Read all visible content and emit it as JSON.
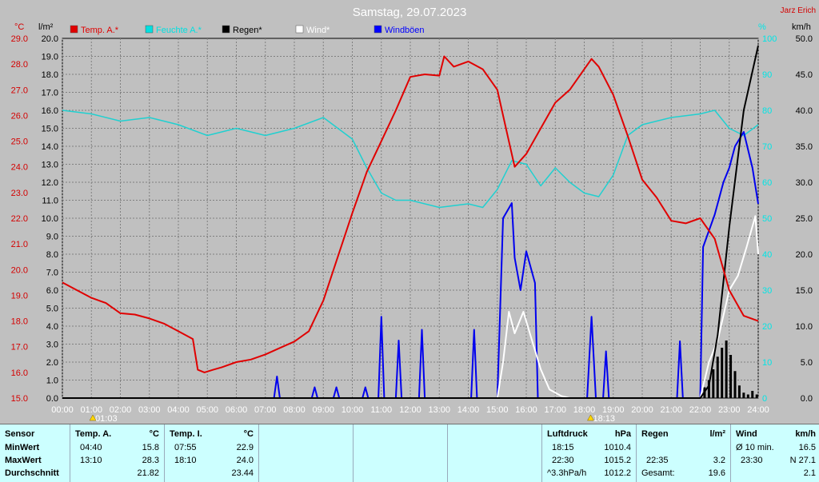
{
  "chart_title": "Samstag, 29.07.2023",
  "author": "Jarz Erich",
  "legend": [
    {
      "name": "Temp. A.*",
      "color": "#e00000"
    },
    {
      "name": "Feuchte A.*",
      "color": "#00e0e0"
    },
    {
      "name": "Regen*",
      "color": "#000000"
    },
    {
      "name": "Wind*",
      "color": "#ffffff"
    },
    {
      "name": "Windböen",
      "color": "#0000ff"
    }
  ],
  "unit_labels": {
    "temp": "°C",
    "rain": "l/m²",
    "humidity": "%",
    "wind": "km/h"
  },
  "markers": [
    {
      "label": "01:03",
      "x": 1.05
    },
    {
      "label": "18:13",
      "x": 18.22
    }
  ],
  "colors": {
    "temp": "#e00000",
    "humidity": "#20d0d0",
    "rain": "#000000",
    "wind": "#ffffff",
    "gusts": "#0000ee",
    "plot_bg": "#c0c0c0",
    "grid": "#808080"
  },
  "chart_data": {
    "type": "line",
    "title": "Samstag, 29.07.2023",
    "x_range": [
      0,
      24
    ],
    "x_ticks": [
      "00:00",
      "01:00",
      "02:00",
      "03:00",
      "04:00",
      "05:00",
      "06:00",
      "07:00",
      "08:00",
      "09:00",
      "10:00",
      "11:00",
      "12:00",
      "13:00",
      "14:00",
      "15:00",
      "16:00",
      "17:00",
      "18:00",
      "19:00",
      "20:00",
      "21:00",
      "22:00",
      "23:00",
      "24:00"
    ],
    "axes": {
      "temp": {
        "range": [
          15,
          29
        ],
        "ticks": [
          "15.0",
          "16.0",
          "17.0",
          "18.0",
          "19.0",
          "20.0",
          "21.0",
          "22.0",
          "23.0",
          "24.0",
          "25.0",
          "26.0",
          "27.0",
          "28.0",
          "29.0"
        ]
      },
      "rain": {
        "range": [
          0,
          20
        ],
        "ticks": [
          "0.0",
          "1.0",
          "2.0",
          "3.0",
          "4.0",
          "5.0",
          "6.0",
          "7.0",
          "8.0",
          "9.0",
          "10.0",
          "11.0",
          "12.0",
          "13.0",
          "14.0",
          "15.0",
          "16.0",
          "17.0",
          "18.0",
          "19.0",
          "20.0"
        ]
      },
      "humidity": {
        "range": [
          0,
          100
        ],
        "ticks": [
          "0",
          "10",
          "20",
          "30",
          "40",
          "50",
          "60",
          "70",
          "80",
          "90",
          "100"
        ]
      },
      "wind": {
        "range": [
          0,
          50
        ],
        "ticks": [
          "0.0",
          "5.0",
          "10.0",
          "15.0",
          "20.0",
          "25.0",
          "30.0",
          "35.0",
          "40.0",
          "45.0",
          "50.0"
        ]
      }
    },
    "series": [
      {
        "name": "Temp. A.*",
        "axis": "temp",
        "points": [
          [
            0,
            19.5
          ],
          [
            0.5,
            19.2
          ],
          [
            1,
            18.9
          ],
          [
            1.5,
            18.7
          ],
          [
            2,
            18.3
          ],
          [
            2.5,
            18.25
          ],
          [
            3,
            18.1
          ],
          [
            3.5,
            17.9
          ],
          [
            4,
            17.6
          ],
          [
            4.5,
            17.3
          ],
          [
            4.67,
            16.1
          ],
          [
            4.9,
            16.0
          ],
          [
            5.2,
            16.1
          ],
          [
            5.5,
            16.2
          ],
          [
            6,
            16.4
          ],
          [
            6.5,
            16.5
          ],
          [
            7,
            16.7
          ],
          [
            7.5,
            16.95
          ],
          [
            8,
            17.2
          ],
          [
            8.5,
            17.6
          ],
          [
            9,
            18.8
          ],
          [
            9.5,
            20.5
          ],
          [
            10,
            22.2
          ],
          [
            10.5,
            23.8
          ],
          [
            11,
            25.0
          ],
          [
            11.5,
            26.2
          ],
          [
            12,
            27.5
          ],
          [
            12.5,
            27.6
          ],
          [
            13,
            27.55
          ],
          [
            13.17,
            28.3
          ],
          [
            13.5,
            27.9
          ],
          [
            14,
            28.1
          ],
          [
            14.5,
            27.8
          ],
          [
            15,
            27.0
          ],
          [
            15.3,
            25.5
          ],
          [
            15.6,
            24.0
          ],
          [
            16,
            24.5
          ],
          [
            16.5,
            25.5
          ],
          [
            17,
            26.5
          ],
          [
            17.5,
            27.0
          ],
          [
            18,
            27.8
          ],
          [
            18.25,
            28.2
          ],
          [
            18.5,
            27.9
          ],
          [
            19,
            26.8
          ],
          [
            19.5,
            25.2
          ],
          [
            20,
            23.5
          ],
          [
            20.5,
            22.8
          ],
          [
            21,
            21.9
          ],
          [
            21.5,
            21.8
          ],
          [
            22,
            22.0
          ],
          [
            22.5,
            21.2
          ],
          [
            23,
            19.2
          ],
          [
            23.5,
            18.2
          ],
          [
            24,
            18.0
          ]
        ]
      },
      {
        "name": "Feuchte A.*",
        "axis": "humidity",
        "points": [
          [
            0,
            80
          ],
          [
            1,
            79
          ],
          [
            2,
            77
          ],
          [
            3,
            78
          ],
          [
            4,
            76
          ],
          [
            5,
            73
          ],
          [
            6,
            75
          ],
          [
            7,
            73
          ],
          [
            8,
            75
          ],
          [
            9,
            78
          ],
          [
            10,
            72
          ],
          [
            10.5,
            64
          ],
          [
            11,
            57
          ],
          [
            11.5,
            55
          ],
          [
            12,
            55
          ],
          [
            13,
            53
          ],
          [
            14,
            54
          ],
          [
            14.5,
            53
          ],
          [
            15,
            58
          ],
          [
            15.5,
            66
          ],
          [
            16,
            65
          ],
          [
            16.5,
            59
          ],
          [
            17,
            64
          ],
          [
            17.5,
            60
          ],
          [
            18,
            57
          ],
          [
            18.5,
            56
          ],
          [
            19,
            62
          ],
          [
            19.5,
            73
          ],
          [
            20,
            76
          ],
          [
            21,
            78
          ],
          [
            22,
            79
          ],
          [
            22.5,
            80
          ],
          [
            23,
            75
          ],
          [
            23.5,
            73
          ],
          [
            24,
            76
          ]
        ]
      },
      {
        "name": "Regen*",
        "axis": "rain",
        "points": [
          [
            0,
            0
          ],
          [
            22,
            0
          ],
          [
            22.3,
            0.7
          ],
          [
            22.6,
            3.5
          ],
          [
            23,
            9.5
          ],
          [
            23.5,
            16
          ],
          [
            24,
            19.6
          ]
        ]
      },
      {
        "name": "Wind*",
        "axis": "wind",
        "points": [
          [
            0,
            0
          ],
          [
            15,
            0
          ],
          [
            15.2,
            5
          ],
          [
            15.4,
            12
          ],
          [
            15.6,
            9
          ],
          [
            15.9,
            12
          ],
          [
            16.2,
            8
          ],
          [
            16.5,
            4
          ],
          [
            16.8,
            1.2
          ],
          [
            17.2,
            0.3
          ],
          [
            17.5,
            0
          ],
          [
            22,
            0
          ],
          [
            22.3,
            5
          ],
          [
            22.6,
            8
          ],
          [
            23,
            15
          ],
          [
            23.3,
            17
          ],
          [
            23.6,
            21
          ],
          [
            23.9,
            25.3
          ],
          [
            24,
            20
          ]
        ]
      },
      {
        "name": "Windböen",
        "axis": "wind",
        "points": [
          [
            0,
            0
          ],
          [
            7.3,
            0
          ],
          [
            7.4,
            3
          ],
          [
            7.5,
            0
          ],
          [
            8.6,
            0
          ],
          [
            8.7,
            1.5
          ],
          [
            8.8,
            0
          ],
          [
            9.35,
            0
          ],
          [
            9.45,
            1.5
          ],
          [
            9.55,
            0
          ],
          [
            10.35,
            0
          ],
          [
            10.45,
            1.5
          ],
          [
            10.55,
            0
          ],
          [
            10.9,
            0
          ],
          [
            11,
            11.3
          ],
          [
            11.1,
            0
          ],
          [
            11.5,
            0
          ],
          [
            11.6,
            8
          ],
          [
            11.7,
            0
          ],
          [
            12.3,
            0
          ],
          [
            12.4,
            9.5
          ],
          [
            12.5,
            0
          ],
          [
            14.1,
            0
          ],
          [
            14.2,
            9.5
          ],
          [
            14.3,
            0
          ],
          [
            15,
            0
          ],
          [
            15.2,
            25
          ],
          [
            15.5,
            27.1
          ],
          [
            15.6,
            19.5
          ],
          [
            15.8,
            15
          ],
          [
            16,
            20.4
          ],
          [
            16.3,
            16
          ],
          [
            16.4,
            0
          ],
          [
            18.1,
            0
          ],
          [
            18.25,
            11.3
          ],
          [
            18.4,
            0
          ],
          [
            18.65,
            0
          ],
          [
            18.75,
            6.5
          ],
          [
            18.85,
            0
          ],
          [
            21.2,
            0
          ],
          [
            21.3,
            7.9
          ],
          [
            21.4,
            0
          ],
          [
            22,
            0
          ],
          [
            22.1,
            21
          ],
          [
            22.5,
            25.5
          ],
          [
            22.8,
            30
          ],
          [
            23,
            32
          ],
          [
            23.2,
            35
          ],
          [
            23.5,
            37
          ],
          [
            23.8,
            32
          ],
          [
            24,
            27
          ]
        ]
      }
    ],
    "rain_bars": [
      [
        22.15,
        0.6
      ],
      [
        22.3,
        1.0
      ],
      [
        22.45,
        1.6
      ],
      [
        22.6,
        2.3
      ],
      [
        22.75,
        2.8
      ],
      [
        22.9,
        3.2
      ],
      [
        23.05,
        2.4
      ],
      [
        23.2,
        1.5
      ],
      [
        23.35,
        0.7
      ],
      [
        23.5,
        0.3
      ],
      [
        23.65,
        0.2
      ],
      [
        23.8,
        0.4
      ],
      [
        23.95,
        0.2
      ]
    ],
    "grid": true,
    "legend_position": "top"
  },
  "stats": {
    "sensor_header": "Sensor",
    "row_labels": [
      "MinWert",
      "MaxWert",
      "Durchschnitt"
    ],
    "groups": [
      {
        "header": "Temp. A.",
        "unit": "°C",
        "rows": [
          [
            "04:40",
            "15.8"
          ],
          [
            "13:10",
            "28.3"
          ],
          [
            "",
            "21.82"
          ]
        ]
      },
      {
        "header": "Temp. I.",
        "unit": "°C",
        "rows": [
          [
            "07:55",
            "22.9"
          ],
          [
            "18:10",
            "24.0"
          ],
          [
            "",
            "23.44"
          ]
        ]
      },
      {
        "header": "Luftdruck",
        "unit": "hPa",
        "rows": [
          [
            "18:15",
            "1010.4"
          ],
          [
            "22:30",
            "1015.2"
          ],
          [
            "^3.3hPa/h",
            "1012.2"
          ]
        ]
      },
      {
        "header": "Regen",
        "unit": "l/m²",
        "rows": [
          [
            "",
            ""
          ],
          [
            "22:35",
            "3.2"
          ],
          [
            "Gesamt:",
            "19.6"
          ]
        ]
      },
      {
        "header": "Wind",
        "unit": "km/h",
        "rows": [
          [
            "Ø 10 min.",
            "16.5"
          ],
          [
            "23:30",
            "N 27.1"
          ],
          [
            "",
            "2.1"
          ]
        ]
      }
    ]
  }
}
